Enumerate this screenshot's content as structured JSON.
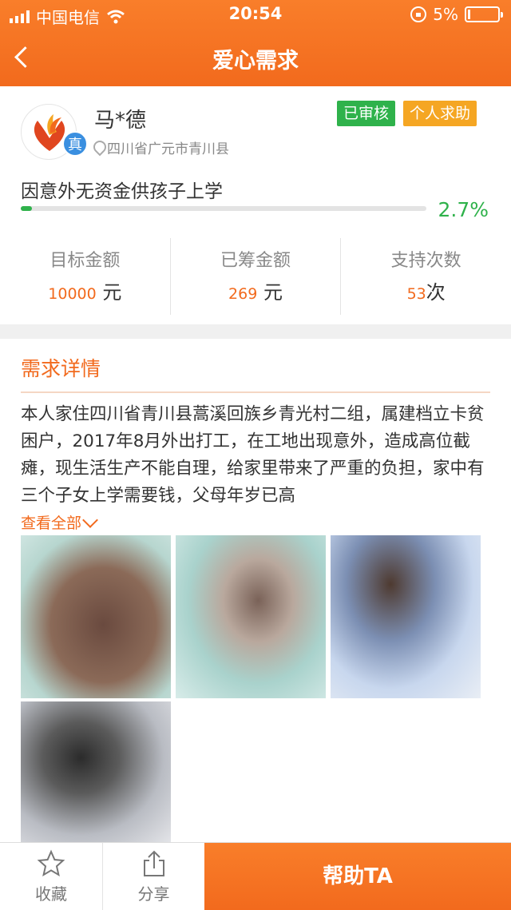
{
  "status_bar": {
    "carrier": "中国电信",
    "time": "20:54",
    "battery": "5%"
  },
  "nav": {
    "title": "爱心需求"
  },
  "profile": {
    "name": "马*德",
    "real_badge": "真",
    "location": "四川省广元市青川县",
    "tags": [
      "已审核",
      "个人求助"
    ]
  },
  "need": {
    "title": "因意外无资金供孩子上学",
    "progress_fraction": 0.027,
    "progress_text": "2.7%"
  },
  "stats": [
    {
      "label": "目标金额",
      "value": "10000",
      "unit": "元"
    },
    {
      "label": "已筹金额",
      "value": "269",
      "unit": "元"
    },
    {
      "label": "支持次数",
      "value": "53",
      "unit": "次"
    }
  ],
  "details": {
    "title": "需求详情",
    "text": "本人家住四川省青川县蒿溪回族乡青光村二组，属建档立卡贫困户，2017年8月外出打工，在工地出现意外，造成高位截瘫，现生活生产不能自理，给家里带来了严重的负担，家中有三个子女上学需要钱，父母年岁已高",
    "more_label": "查看全部"
  },
  "tabbar": {
    "favorite_label": "收藏",
    "share_label": "分享",
    "help_label": "帮助TA"
  },
  "colors": {
    "accent": "#f26a1d",
    "green": "#2fb24b",
    "badge_blue": "#3a8fe0",
    "tag_orange": "#f5a623"
  }
}
